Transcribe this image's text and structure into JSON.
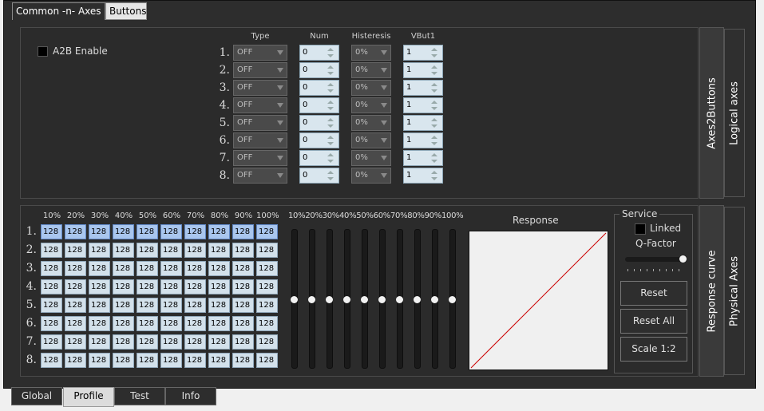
{
  "top_tabs": [
    {
      "label": "Common -n- Axes",
      "active": true
    },
    {
      "label": "Buttons",
      "active": false
    }
  ],
  "a2b": {
    "label": "A2B Enable",
    "checked": false
  },
  "table_headers": {
    "type": "Type",
    "num": "Num",
    "histeresis": "Histeresis",
    "vbut": "VBut1"
  },
  "a2b_rows": [
    {
      "n": "1.",
      "type": "OFF",
      "num": "0",
      "hist": "0%",
      "vbut": "1"
    },
    {
      "n": "2.",
      "type": "OFF",
      "num": "0",
      "hist": "0%",
      "vbut": "1"
    },
    {
      "n": "3.",
      "type": "OFF",
      "num": "0",
      "hist": "0%",
      "vbut": "1"
    },
    {
      "n": "4.",
      "type": "OFF",
      "num": "0",
      "hist": "0%",
      "vbut": "1"
    },
    {
      "n": "5.",
      "type": "OFF",
      "num": "0",
      "hist": "0%",
      "vbut": "1"
    },
    {
      "n": "6.",
      "type": "OFF",
      "num": "0",
      "hist": "0%",
      "vbut": "1"
    },
    {
      "n": "7.",
      "type": "OFF",
      "num": "0",
      "hist": "0%",
      "vbut": "1"
    },
    {
      "n": "8.",
      "type": "OFF",
      "num": "0",
      "hist": "0%",
      "vbut": "1"
    }
  ],
  "side_tabs_top": {
    "inner": "Axes2Buttons",
    "outer": "Logical axes"
  },
  "side_tabs_bottom": {
    "inner": "Response curve",
    "outer": "Physical Axes"
  },
  "curve": {
    "col_headers": [
      "10%",
      "20%",
      "30%",
      "40%",
      "50%",
      "60%",
      "70%",
      "80%",
      "90%",
      "100%"
    ],
    "row_labels": [
      "1.",
      "2.",
      "3.",
      "4.",
      "5.",
      "6.",
      "7.",
      "8."
    ],
    "values": [
      [
        "128",
        "128",
        "128",
        "128",
        "128",
        "128",
        "128",
        "128",
        "128",
        "128"
      ],
      [
        "128",
        "128",
        "128",
        "128",
        "128",
        "128",
        "128",
        "128",
        "128",
        "128"
      ],
      [
        "128",
        "128",
        "128",
        "128",
        "128",
        "128",
        "128",
        "128",
        "128",
        "128"
      ],
      [
        "128",
        "128",
        "128",
        "128",
        "128",
        "128",
        "128",
        "128",
        "128",
        "128"
      ],
      [
        "128",
        "128",
        "128",
        "128",
        "128",
        "128",
        "128",
        "128",
        "128",
        "128"
      ],
      [
        "128",
        "128",
        "128",
        "128",
        "128",
        "128",
        "128",
        "128",
        "128",
        "128"
      ],
      [
        "128",
        "128",
        "128",
        "128",
        "128",
        "128",
        "128",
        "128",
        "128",
        "128"
      ],
      [
        "128",
        "128",
        "128",
        "128",
        "128",
        "128",
        "128",
        "128",
        "128",
        "128"
      ]
    ],
    "highlighted_row": 0
  },
  "sliders": {
    "header": "10%20%30%40%50%60%70%80%90%100%",
    "levels": [
      0.5,
      0.5,
      0.5,
      0.5,
      0.5,
      0.5,
      0.5,
      0.5,
      0.5,
      0.5
    ]
  },
  "response": {
    "title": "Response",
    "line_color": "#cc0000"
  },
  "service": {
    "title": "Service",
    "linked_label": "Linked",
    "linked_checked": false,
    "qfactor_label": "Q-Factor",
    "qfactor_level": 1.0,
    "reset_label": "Reset",
    "reset_all_label": "Reset All",
    "scale_label": "Scale 1:2"
  },
  "bottom_tabs": [
    {
      "label": "Global",
      "active": false
    },
    {
      "label": "Profile",
      "active": true
    },
    {
      "label": "Test",
      "active": false
    },
    {
      "label": "Info",
      "active": false
    }
  ]
}
